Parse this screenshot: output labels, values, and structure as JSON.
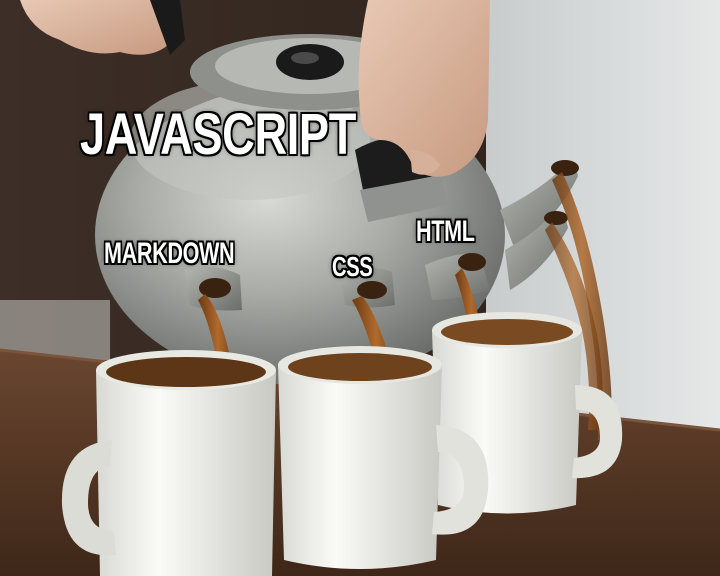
{
  "labels": {
    "javascript": "JAVASCRIPT",
    "markdown": "MARKDOWN",
    "css": "CSS",
    "html": "HTML"
  },
  "colors": {
    "wall_left": "#3a2c24",
    "wall_right": "#d8dada",
    "table": "#5a3a26",
    "teapot": "#a8aaa6",
    "tea": "#8a5020",
    "mug": "#f2f2ee"
  }
}
